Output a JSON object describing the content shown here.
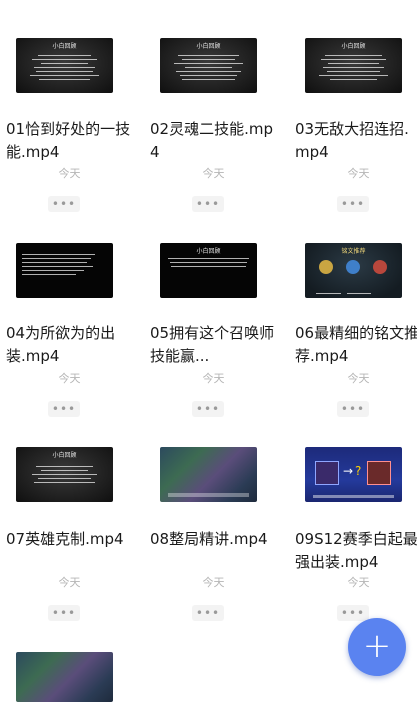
{
  "files": [
    {
      "name": "01恰到好处的一技能.mp4",
      "date": "今天",
      "more": "•••",
      "thumb_title": "小白回顾"
    },
    {
      "name": "02灵魂二技能.mp4",
      "date": "今天",
      "more": "•••",
      "thumb_title": "小白回顾"
    },
    {
      "name": "03无敌大招连招.mp4",
      "date": "今天",
      "more": "•••",
      "thumb_title": "小白回顾"
    },
    {
      "name": "04为所欲为的出装.mp4",
      "date": "今天",
      "more": "•••",
      "thumb_title": ""
    },
    {
      "name": "05拥有这个召唤师技能赢...",
      "date": "今天",
      "more": "•••",
      "thumb_title": "小白回顾"
    },
    {
      "name": "06最精细的铭文推荐.mp4",
      "date": "今天",
      "more": "•••",
      "thumb_title": "铭文推荐"
    },
    {
      "name": "07英雄克制.mp4",
      "date": "今天",
      "more": "•••",
      "thumb_title": "小白回顾"
    },
    {
      "name": "08整局精讲.mp4",
      "date": "今天",
      "more": "•••",
      "thumb_title": ""
    },
    {
      "name": "09S12赛季白起最强出装.mp4",
      "date": "今天",
      "more": "•••",
      "thumb_title": ""
    }
  ],
  "fab": {
    "label": "+",
    "icon": "plus-icon"
  },
  "colors": {
    "accent": "#5a83f0",
    "date_gray": "#b5b5b5"
  }
}
